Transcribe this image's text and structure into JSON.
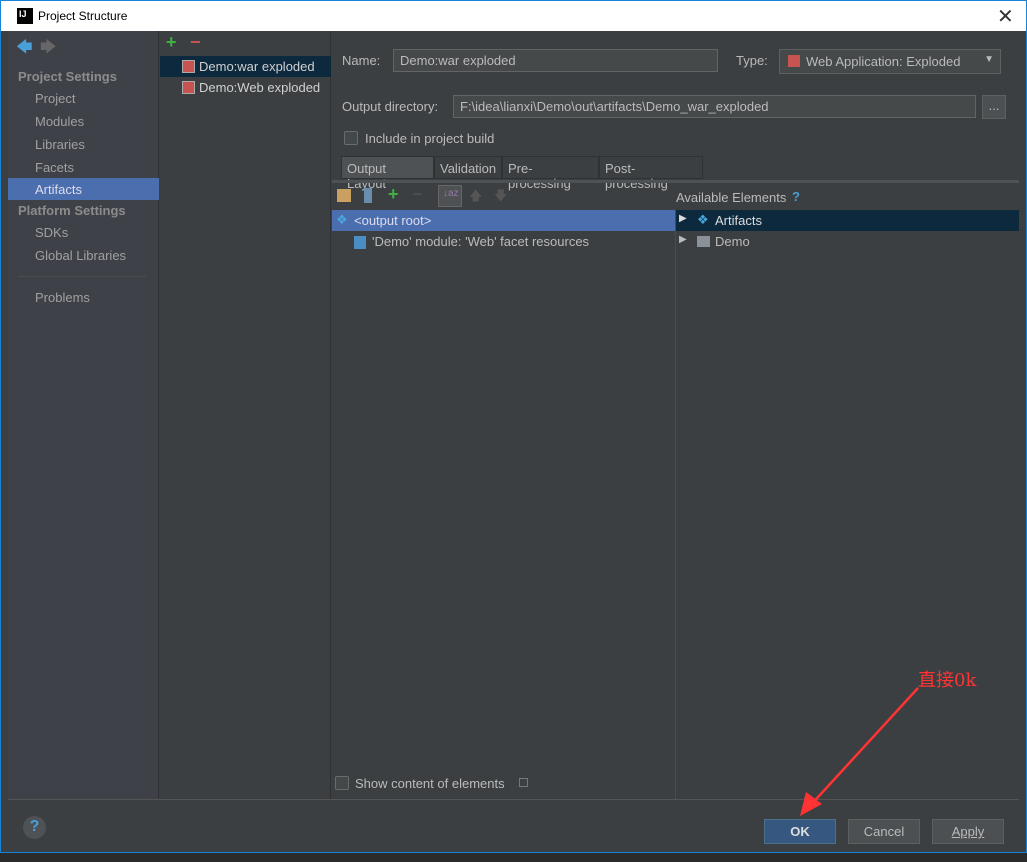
{
  "window": {
    "title": "Project Structure",
    "close": "✕",
    "logo": "IJ"
  },
  "sidebar": {
    "back": "🡄",
    "forward": "🡆",
    "project_settings": "Project Settings",
    "platform_settings": "Platform Settings",
    "items": [
      {
        "label": "Project"
      },
      {
        "label": "Modules"
      },
      {
        "label": "Libraries"
      },
      {
        "label": "Facets"
      },
      {
        "label": "Artifacts"
      }
    ],
    "platform_items": [
      {
        "label": "SDKs"
      },
      {
        "label": "Global Libraries"
      }
    ],
    "problems": "Problems"
  },
  "artifacts": {
    "add": "+",
    "remove": "−",
    "items": [
      {
        "label": "Demo:war exploded"
      },
      {
        "label": "Demo:Web exploded"
      }
    ]
  },
  "form": {
    "name_label": "Name:",
    "name_value": "Demo:war exploded",
    "type_label": "Type:",
    "type_value": "Web Application: Exploded",
    "output_label": "Output directory:",
    "output_value": "F:\\idea\\lianxi\\Demo\\out\\artifacts\\Demo_war_exploded",
    "browse": "...",
    "include_label": "Include in project build"
  },
  "tabs": [
    {
      "label": "Output Layout"
    },
    {
      "label": "Validation"
    },
    {
      "label": "Pre-processing"
    },
    {
      "label": "Post-processing"
    }
  ],
  "layout": {
    "tree": [
      {
        "label": "<output root>"
      },
      {
        "label": "'Demo' module: 'Web' facet resources"
      }
    ],
    "available_title": "Available Elements",
    "help": "?",
    "available": [
      {
        "label": "Artifacts"
      },
      {
        "label": "Demo"
      }
    ],
    "show_content": "Show content of elements"
  },
  "footer": {
    "help": "?",
    "ok": "OK",
    "cancel": "Cancel",
    "apply": "Apply"
  },
  "annotation": {
    "text": "直接0k",
    "color": "#ff3333"
  }
}
